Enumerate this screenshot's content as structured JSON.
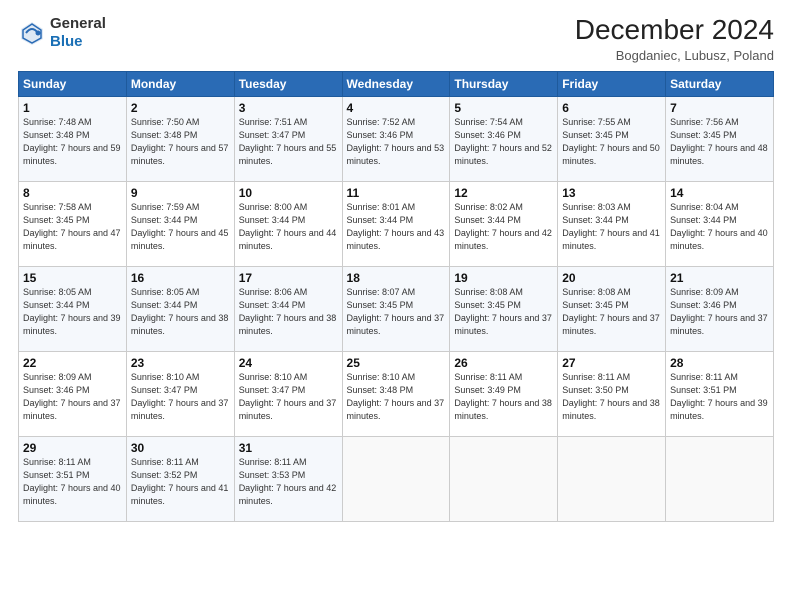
{
  "header": {
    "logo_general": "General",
    "logo_blue": "Blue",
    "title": "December 2024",
    "subtitle": "Bogdaniec, Lubusz, Poland"
  },
  "weekdays": [
    "Sunday",
    "Monday",
    "Tuesday",
    "Wednesday",
    "Thursday",
    "Friday",
    "Saturday"
  ],
  "weeks": [
    [
      {
        "day": "1",
        "sunrise": "Sunrise: 7:48 AM",
        "sunset": "Sunset: 3:48 PM",
        "daylight": "Daylight: 7 hours and 59 minutes."
      },
      {
        "day": "2",
        "sunrise": "Sunrise: 7:50 AM",
        "sunset": "Sunset: 3:48 PM",
        "daylight": "Daylight: 7 hours and 57 minutes."
      },
      {
        "day": "3",
        "sunrise": "Sunrise: 7:51 AM",
        "sunset": "Sunset: 3:47 PM",
        "daylight": "Daylight: 7 hours and 55 minutes."
      },
      {
        "day": "4",
        "sunrise": "Sunrise: 7:52 AM",
        "sunset": "Sunset: 3:46 PM",
        "daylight": "Daylight: 7 hours and 53 minutes."
      },
      {
        "day": "5",
        "sunrise": "Sunrise: 7:54 AM",
        "sunset": "Sunset: 3:46 PM",
        "daylight": "Daylight: 7 hours and 52 minutes."
      },
      {
        "day": "6",
        "sunrise": "Sunrise: 7:55 AM",
        "sunset": "Sunset: 3:45 PM",
        "daylight": "Daylight: 7 hours and 50 minutes."
      },
      {
        "day": "7",
        "sunrise": "Sunrise: 7:56 AM",
        "sunset": "Sunset: 3:45 PM",
        "daylight": "Daylight: 7 hours and 48 minutes."
      }
    ],
    [
      {
        "day": "8",
        "sunrise": "Sunrise: 7:58 AM",
        "sunset": "Sunset: 3:45 PM",
        "daylight": "Daylight: 7 hours and 47 minutes."
      },
      {
        "day": "9",
        "sunrise": "Sunrise: 7:59 AM",
        "sunset": "Sunset: 3:44 PM",
        "daylight": "Daylight: 7 hours and 45 minutes."
      },
      {
        "day": "10",
        "sunrise": "Sunrise: 8:00 AM",
        "sunset": "Sunset: 3:44 PM",
        "daylight": "Daylight: 7 hours and 44 minutes."
      },
      {
        "day": "11",
        "sunrise": "Sunrise: 8:01 AM",
        "sunset": "Sunset: 3:44 PM",
        "daylight": "Daylight: 7 hours and 43 minutes."
      },
      {
        "day": "12",
        "sunrise": "Sunrise: 8:02 AM",
        "sunset": "Sunset: 3:44 PM",
        "daylight": "Daylight: 7 hours and 42 minutes."
      },
      {
        "day": "13",
        "sunrise": "Sunrise: 8:03 AM",
        "sunset": "Sunset: 3:44 PM",
        "daylight": "Daylight: 7 hours and 41 minutes."
      },
      {
        "day": "14",
        "sunrise": "Sunrise: 8:04 AM",
        "sunset": "Sunset: 3:44 PM",
        "daylight": "Daylight: 7 hours and 40 minutes."
      }
    ],
    [
      {
        "day": "15",
        "sunrise": "Sunrise: 8:05 AM",
        "sunset": "Sunset: 3:44 PM",
        "daylight": "Daylight: 7 hours and 39 minutes."
      },
      {
        "day": "16",
        "sunrise": "Sunrise: 8:05 AM",
        "sunset": "Sunset: 3:44 PM",
        "daylight": "Daylight: 7 hours and 38 minutes."
      },
      {
        "day": "17",
        "sunrise": "Sunrise: 8:06 AM",
        "sunset": "Sunset: 3:44 PM",
        "daylight": "Daylight: 7 hours and 38 minutes."
      },
      {
        "day": "18",
        "sunrise": "Sunrise: 8:07 AM",
        "sunset": "Sunset: 3:45 PM",
        "daylight": "Daylight: 7 hours and 37 minutes."
      },
      {
        "day": "19",
        "sunrise": "Sunrise: 8:08 AM",
        "sunset": "Sunset: 3:45 PM",
        "daylight": "Daylight: 7 hours and 37 minutes."
      },
      {
        "day": "20",
        "sunrise": "Sunrise: 8:08 AM",
        "sunset": "Sunset: 3:45 PM",
        "daylight": "Daylight: 7 hours and 37 minutes."
      },
      {
        "day": "21",
        "sunrise": "Sunrise: 8:09 AM",
        "sunset": "Sunset: 3:46 PM",
        "daylight": "Daylight: 7 hours and 37 minutes."
      }
    ],
    [
      {
        "day": "22",
        "sunrise": "Sunrise: 8:09 AM",
        "sunset": "Sunset: 3:46 PM",
        "daylight": "Daylight: 7 hours and 37 minutes."
      },
      {
        "day": "23",
        "sunrise": "Sunrise: 8:10 AM",
        "sunset": "Sunset: 3:47 PM",
        "daylight": "Daylight: 7 hours and 37 minutes."
      },
      {
        "day": "24",
        "sunrise": "Sunrise: 8:10 AM",
        "sunset": "Sunset: 3:47 PM",
        "daylight": "Daylight: 7 hours and 37 minutes."
      },
      {
        "day": "25",
        "sunrise": "Sunrise: 8:10 AM",
        "sunset": "Sunset: 3:48 PM",
        "daylight": "Daylight: 7 hours and 37 minutes."
      },
      {
        "day": "26",
        "sunrise": "Sunrise: 8:11 AM",
        "sunset": "Sunset: 3:49 PM",
        "daylight": "Daylight: 7 hours and 38 minutes."
      },
      {
        "day": "27",
        "sunrise": "Sunrise: 8:11 AM",
        "sunset": "Sunset: 3:50 PM",
        "daylight": "Daylight: 7 hours and 38 minutes."
      },
      {
        "day": "28",
        "sunrise": "Sunrise: 8:11 AM",
        "sunset": "Sunset: 3:51 PM",
        "daylight": "Daylight: 7 hours and 39 minutes."
      }
    ],
    [
      {
        "day": "29",
        "sunrise": "Sunrise: 8:11 AM",
        "sunset": "Sunset: 3:51 PM",
        "daylight": "Daylight: 7 hours and 40 minutes."
      },
      {
        "day": "30",
        "sunrise": "Sunrise: 8:11 AM",
        "sunset": "Sunset: 3:52 PM",
        "daylight": "Daylight: 7 hours and 41 minutes."
      },
      {
        "day": "31",
        "sunrise": "Sunrise: 8:11 AM",
        "sunset": "Sunset: 3:53 PM",
        "daylight": "Daylight: 7 hours and 42 minutes."
      },
      null,
      null,
      null,
      null
    ]
  ]
}
